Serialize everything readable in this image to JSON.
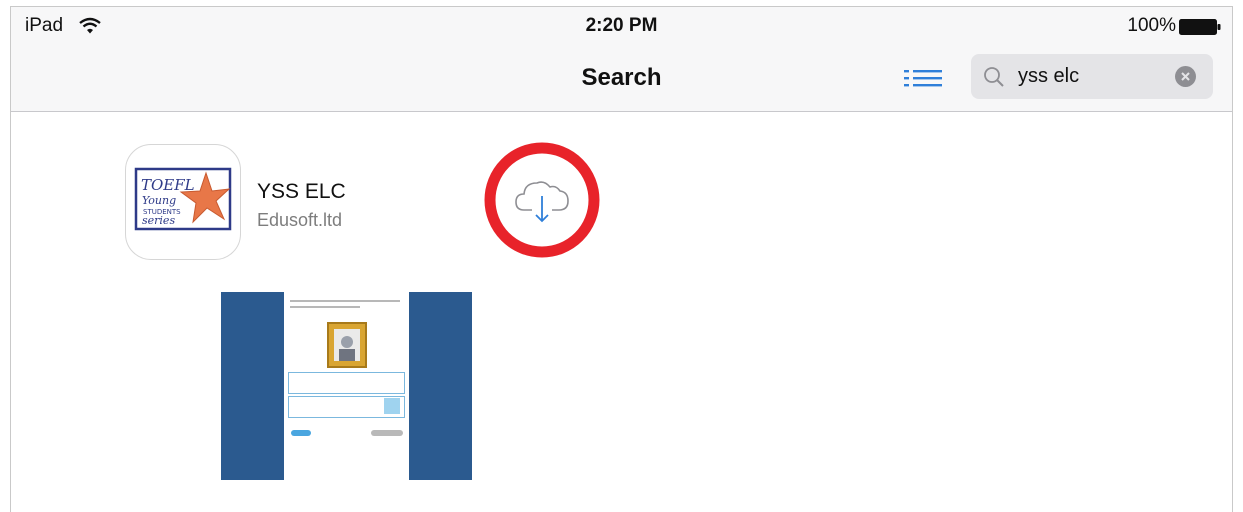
{
  "status_bar": {
    "device": "iPad",
    "time": "2:20 PM",
    "battery": "100%",
    "icons": [
      "wifi-icon",
      "battery-icon"
    ]
  },
  "nav_bar": {
    "title": "Search",
    "list_button_icon": "list-icon",
    "search": {
      "value": "yss elc",
      "icon": "search-icon",
      "clear_icon": "clear-icon"
    }
  },
  "result": {
    "app_name": "YSS ELC",
    "developer": "Edusoft.ltd",
    "icon_logo": "TOEFL Young Students series",
    "download_icon": "cloud-download-icon",
    "highlight_color": "#e8232a",
    "accent_color": "#2f7fd9"
  },
  "screenshot": {
    "background_color": "#2b5a8f"
  }
}
